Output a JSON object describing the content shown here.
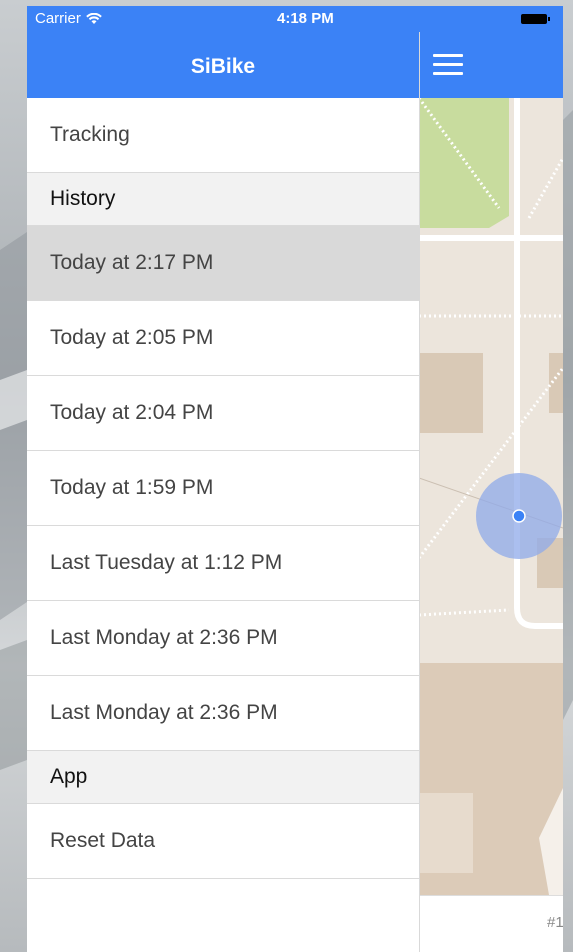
{
  "status_bar": {
    "carrier": "Carrier",
    "time": "4:18 PM"
  },
  "app": {
    "title": "SiBike",
    "accent_color": "#3b82f6"
  },
  "menu": {
    "tracking_label": "Tracking",
    "history_header": "History",
    "history": [
      "Today at 2:17 PM",
      "Today at 2:05 PM",
      "Today at 2:04 PM",
      "Today at 1:59 PM",
      "Last Tuesday at 1:12 PM",
      "Last Monday at 2:36 PM",
      "Last Monday at 2:36 PM"
    ],
    "selected_index": 0,
    "app_header": "App",
    "reset_label": "Reset Data"
  },
  "map": {
    "footer_text": "#1"
  }
}
